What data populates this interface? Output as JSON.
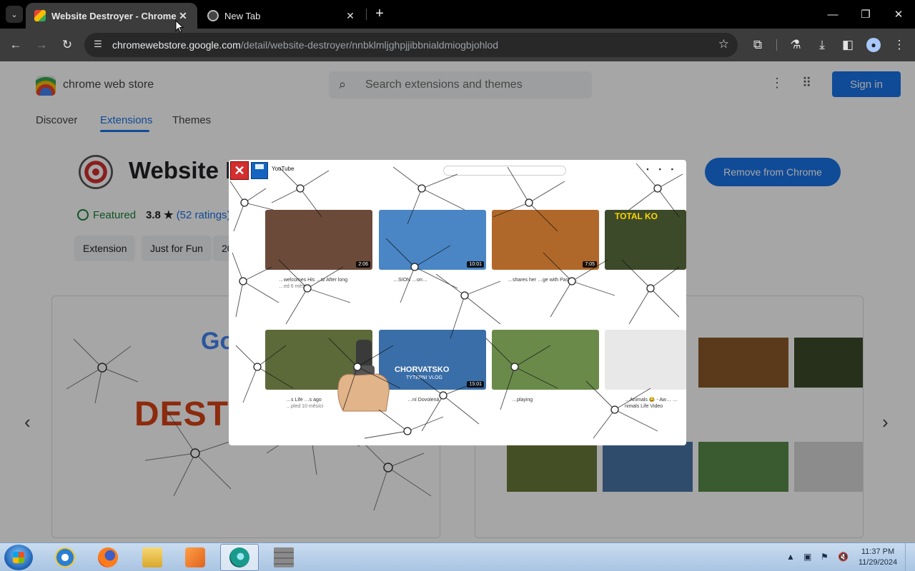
{
  "browser": {
    "tabs": [
      {
        "title": "Website Destroyer - Chrome Web Store",
        "active": true
      },
      {
        "title": "New Tab",
        "active": false
      }
    ],
    "new_tab_symbol": "+",
    "close_symbol": "✕",
    "url_host": "chromewebstore.google.com",
    "url_path": "/detail/website-destroyer/nnbklmljghpjjibbnialdmiogbjohlod",
    "window_controls": {
      "minimize": "—",
      "restore": "❐",
      "close": "✕"
    }
  },
  "store": {
    "name": "chrome web store",
    "search_placeholder": "Search extensions and themes",
    "sign_in": "Sign in",
    "nav": [
      "Discover",
      "Extensions",
      "Themes"
    ],
    "extension": {
      "title": "Website Destroyer",
      "badge": "Featured",
      "rating": "3.8 ★",
      "ratings_link": "(52 ratings)",
      "chips": [
        "Extension",
        "Just for Fun",
        "20"
      ],
      "remove_button": "Remove from Chrome"
    },
    "screenshot_words": {
      "destroy": "DESTROY",
      "google": "Google"
    },
    "carousel": {
      "prev": "‹",
      "next": "›"
    }
  },
  "overlay": {
    "close_label": "✕",
    "yt_logo": "YouTube",
    "videos": [
      {
        "duration": "2:06",
        "title": "…welcomes His …tz After long",
        "meta": "…ed 6 měsíci",
        "color": "#6b4a3a"
      },
      {
        "duration": "10:01",
        "title": "…SION …on…",
        "meta": "",
        "color": "#4a86c5"
      },
      {
        "duration": "7:05",
        "title": "…shares her …ge with Pasta…",
        "meta": "",
        "color": "#b0682a"
      },
      {
        "duration": "",
        "title": "",
        "meta": "",
        "color": "#3d4a2a"
      },
      {
        "duration": "",
        "title": "…s Life …s ago",
        "meta": "…pled 10 měsíci",
        "color": "#5c6a3a"
      },
      {
        "duration": "19:01",
        "title": "…ní Dovolená",
        "meta": "",
        "color": "#3a6ea8"
      },
      {
        "duration": "",
        "title": "…playing",
        "meta": "",
        "color": "#6a8a4a"
      },
      {
        "duration": "",
        "title": "…Animals 😂 - Aw… …nimals Life Video",
        "meta": "",
        "color": "#e8e8e8"
      }
    ],
    "thumb_words": {
      "croatia": "CHORVATSKO",
      "vlog": "TYTEPNI VLOG",
      "total": "TOTAL KO"
    }
  },
  "taskbar": {
    "time": "11:37 PM",
    "date": "11/29/2024",
    "tray_up": "▲",
    "tray_flag": "⚑"
  },
  "colors": {
    "accent": "#1a73e8",
    "brand_red": "#d84315"
  }
}
